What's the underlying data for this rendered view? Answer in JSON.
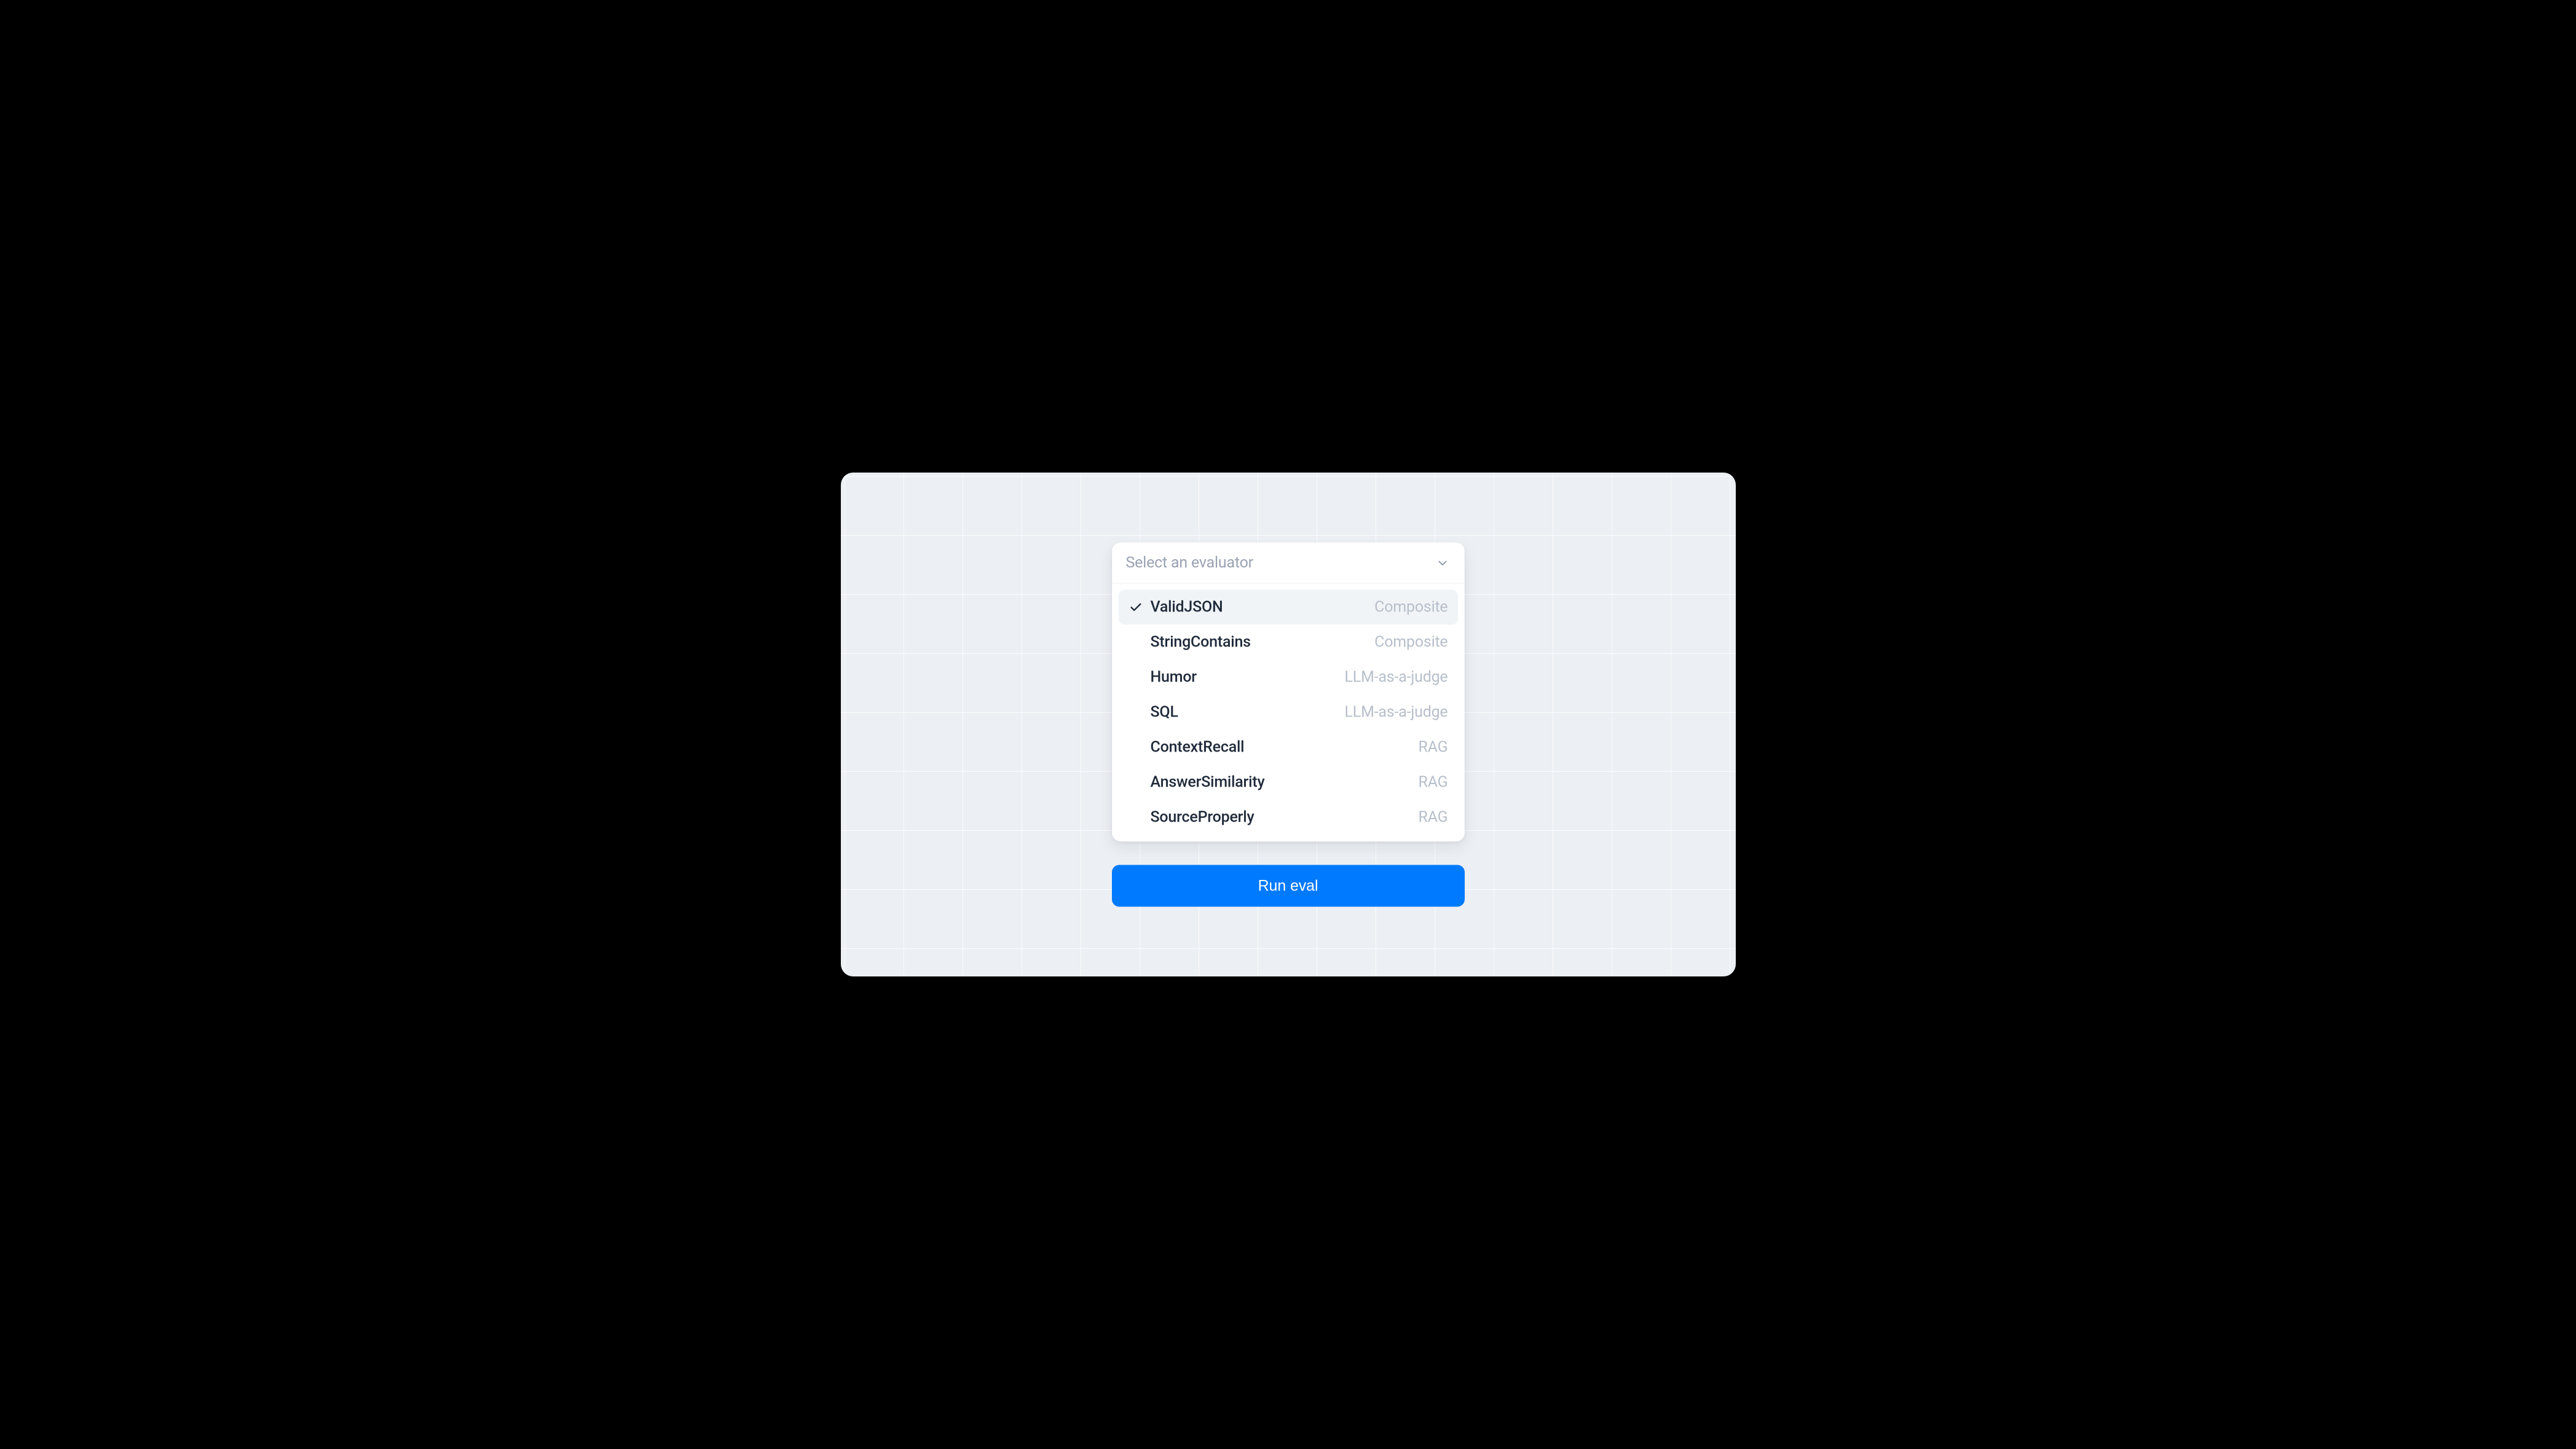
{
  "dropdown": {
    "placeholder": "Select an evaluator",
    "options": [
      {
        "label": "ValidJSON",
        "tag": "Composite",
        "selected": true
      },
      {
        "label": "StringContains",
        "tag": "Composite",
        "selected": false
      },
      {
        "label": "Humor",
        "tag": "LLM-as-a-judge",
        "selected": false
      },
      {
        "label": "SQL",
        "tag": "LLM-as-a-judge",
        "selected": false
      },
      {
        "label": "ContextRecall",
        "tag": "RAG",
        "selected": false
      },
      {
        "label": "AnswerSimilarity",
        "tag": "RAG",
        "selected": false
      },
      {
        "label": "SourceProperly",
        "tag": "RAG",
        "selected": false
      }
    ]
  },
  "actions": {
    "run_label": "Run eval"
  },
  "colors": {
    "accent": "#007aff",
    "surface": "#ffffff",
    "canvas": "#eceff3",
    "text_primary": "#1f2a3a",
    "text_muted": "#99a2b2",
    "option_selected_bg": "#f1f4f7"
  }
}
